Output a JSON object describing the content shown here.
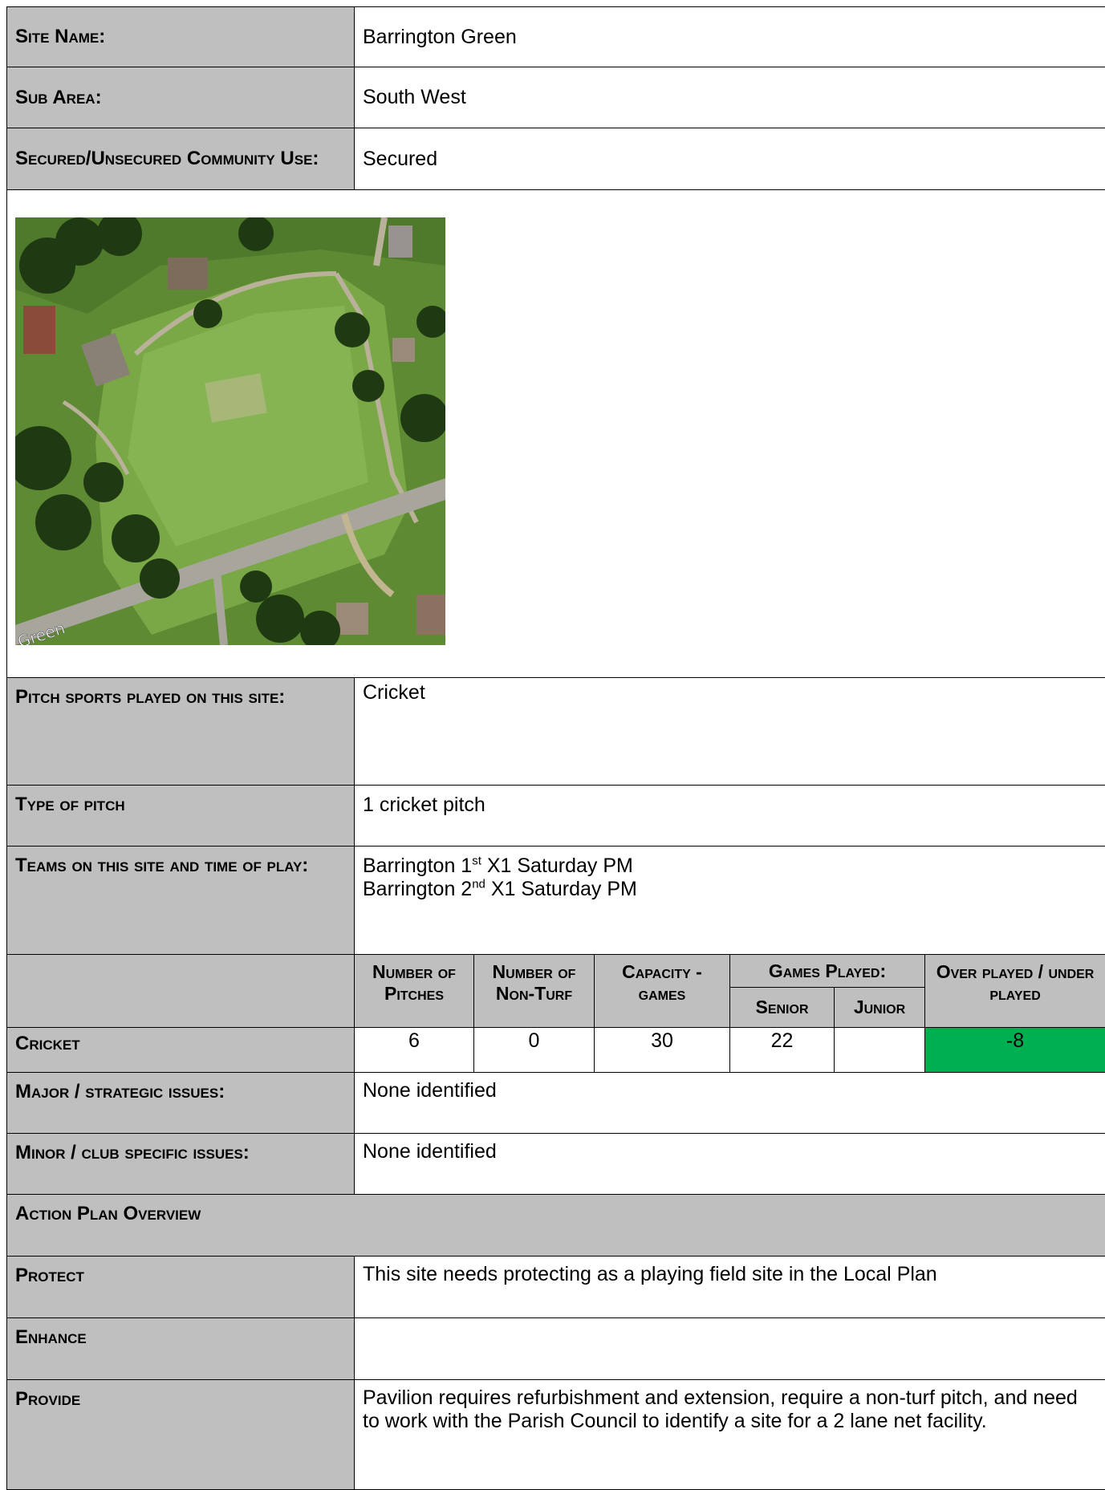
{
  "site": {
    "name_label": "Site Name:",
    "name_value": "Barrington Green",
    "sub_area_label": "Sub Area:",
    "sub_area_value": "South West",
    "secured_label": "Secured/Unsecured Community Use:",
    "secured_value": "Secured"
  },
  "map": {
    "icon": "aerial-photo",
    "road_label": "Green",
    "colors": {
      "grass": "#6f9b3c",
      "road": "#a8a69c",
      "trees": "#1f3a12"
    }
  },
  "details": {
    "sports_label": "Pitch sports played on this site:",
    "sports_value": "Cricket",
    "type_label": "Type of pitch",
    "type_value": "1 cricket pitch",
    "teams_label": "Teams on this site and time of play:",
    "teams": [
      {
        "prefix": "Barrington 1",
        "sup": "st",
        "suffix": " X1 Saturday PM"
      },
      {
        "prefix": "Barrington 2",
        "sup": "nd",
        "suffix": " X1 Saturday PM"
      }
    ]
  },
  "capacity": {
    "headers": {
      "pitches": "Number of Pitches",
      "non_turf": "Number of Non-Turf",
      "capacity": "Capacity - games",
      "games_played": "Games Played:",
      "senior": "Senior",
      "junior": "Junior",
      "over_under": "Over played / under played"
    },
    "row": {
      "label": "Cricket",
      "pitches": "6",
      "non_turf": "0",
      "capacity": "30",
      "senior": "22",
      "junior": "",
      "over_under": "-8",
      "over_under_color": "#00b050"
    }
  },
  "issues": {
    "major_label": "Major / strategic issues:",
    "major_value": "None identified",
    "minor_label": "Minor / club specific issues:",
    "minor_value": "None identified"
  },
  "action_plan": {
    "title": "Action Plan Overview",
    "protect_label": "Protect",
    "protect_value": "This site needs protecting as a playing field site in the Local Plan",
    "enhance_label": "Enhance",
    "enhance_value": "",
    "provide_label": "Provide",
    "provide_value": "Pavilion requires refurbishment and extension, require a non-turf pitch, and need to work with the Parish Council to identify a site for a 2 lane net facility."
  }
}
